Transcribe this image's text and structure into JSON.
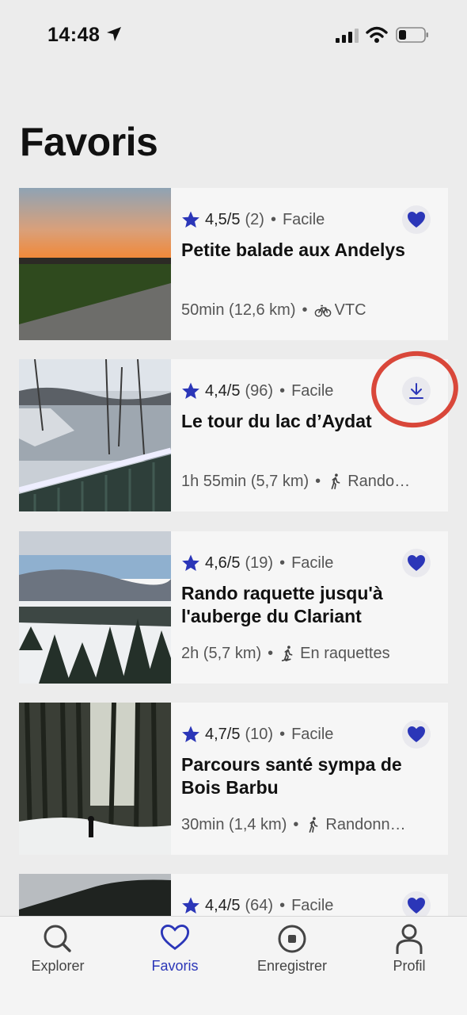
{
  "status_bar": {
    "time": "14:48"
  },
  "page": {
    "title": "Favoris"
  },
  "cards": [
    {
      "rating": "4,5/5",
      "count": "(2)",
      "difficulty": "Facile",
      "title": "Petite balade aux Andelys",
      "duration": "50min (12,6 km)",
      "activity": "VTC",
      "activity_icon": "bike-icon",
      "action": "heart-icon"
    },
    {
      "rating": "4,4/5",
      "count": "(96)",
      "difficulty": "Facile",
      "title": "Le tour du lac d’Aydat",
      "duration": "1h 55min (5,7 km)",
      "activity": "Rando…",
      "activity_icon": "hiker-icon",
      "action": "download-icon"
    },
    {
      "rating": "4,6/5",
      "count": "(19)",
      "difficulty": "Facile",
      "title": "Rando raquette jusqu'à l'auberge du Clariant",
      "duration": "2h (5,7 km)",
      "activity": "En raquettes",
      "activity_icon": "snowshoe-icon",
      "action": "heart-icon"
    },
    {
      "rating": "4,7/5",
      "count": "(10)",
      "difficulty": "Facile",
      "title": "Parcours santé sympa de Bois Barbu",
      "duration": "30min (1,4 km)",
      "activity": "Randonn…",
      "activity_icon": "hiker-icon",
      "action": "heart-icon"
    },
    {
      "rating": "4,4/5",
      "count": "(64)",
      "difficulty": "Facile",
      "action": "heart-icon"
    }
  ],
  "tabs": [
    {
      "label": "Explorer",
      "icon": "search-icon"
    },
    {
      "label": "Favoris",
      "icon": "heart-icon",
      "active": true
    },
    {
      "label": "Enregistrer",
      "icon": "record-icon"
    },
    {
      "label": "Profil",
      "icon": "person-icon"
    }
  ],
  "colors": {
    "accent": "#2b36b8",
    "annotation": "#d9473a",
    "background": "#ececec",
    "card": "#f6f6f6"
  }
}
